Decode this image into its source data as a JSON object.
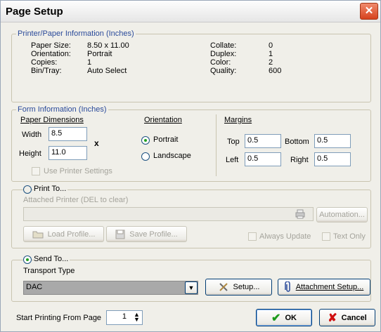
{
  "window": {
    "title": "Page Setup"
  },
  "printer_info": {
    "legend": "Printer/Paper Information (Inches)",
    "left": [
      {
        "label": "Paper Size:",
        "value": "8.50 x 11.00"
      },
      {
        "label": "Orientation:",
        "value": "Portrait"
      },
      {
        "label": "Copies:",
        "value": "1"
      },
      {
        "label": "Bin/Tray:",
        "value": "Auto Select"
      }
    ],
    "right": [
      {
        "label": "Collate:",
        "value": "0"
      },
      {
        "label": "Duplex:",
        "value": "1"
      },
      {
        "label": "Color:",
        "value": "2"
      },
      {
        "label": "Quality:",
        "value": "600"
      }
    ]
  },
  "form_info": {
    "legend": "Form Information (Inches)",
    "paper_dimensions": {
      "heading": "Paper Dimensions",
      "width_label": "Width",
      "width_value": "8.5",
      "height_label": "Height",
      "height_value": "11.0",
      "x_symbol": "x",
      "use_printer_settings": "Use Printer Settings"
    },
    "orientation": {
      "heading": "Orientation",
      "portrait": "Portrait",
      "landscape": "Landscape",
      "selected": "Portrait"
    },
    "margins": {
      "heading": "Margins",
      "top_label": "Top",
      "top_value": "0.5",
      "bottom_label": "Bottom",
      "bottom_value": "0.5",
      "left_label": "Left",
      "left_value": "0.5",
      "right_label": "Right",
      "right_value": "0.5"
    }
  },
  "print_to": {
    "label": "Print To...",
    "attached_printer_label": "Attached Printer (DEL to clear)",
    "attached_printer_value": "",
    "automation_button": "Automation...",
    "load_profile_button": "Load Profile...",
    "save_profile_button": "Save Profile...",
    "always_update": "Always Update",
    "text_only": "Text Only"
  },
  "send_to": {
    "label": "Send To...",
    "transport_type_label": "Transport Type",
    "transport_value": "DAC",
    "setup_button": "Setup...",
    "attachment_setup_button": "Attachment Setup..."
  },
  "footer": {
    "start_page_label": "Start Printing From Page",
    "start_page_value": "1",
    "ok_button": "OK",
    "cancel_button": "Cancel"
  },
  "colors": {
    "accent": "#2a4a9a",
    "ok_check": "#1c9a1c",
    "cancel_x": "#d01010",
    "close": "#d6421d"
  }
}
